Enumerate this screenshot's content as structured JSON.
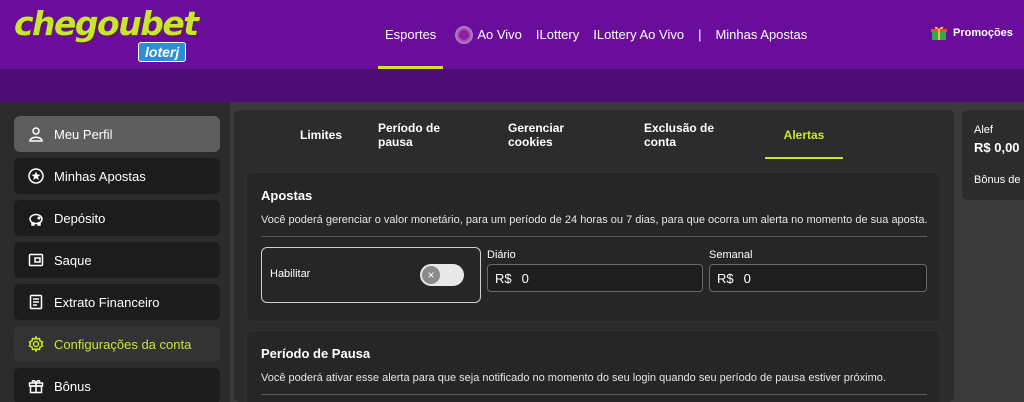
{
  "logo": {
    "main": "chegoubet",
    "sub": "loterj"
  },
  "nav": {
    "items": [
      {
        "label": "Esportes"
      },
      {
        "label": "Ao Vivo"
      },
      {
        "label": "ILottery"
      },
      {
        "label": "ILottery Ao Vivo"
      },
      {
        "label": "Minhas Apostas"
      }
    ],
    "separator": "|",
    "promo_label": "Promoções"
  },
  "sidebar": {
    "items": [
      {
        "label": "Meu Perfil",
        "icon": "user-icon"
      },
      {
        "label": "Minhas Apostas",
        "icon": "star-icon"
      },
      {
        "label": "Depósito",
        "icon": "piggy-bank-icon"
      },
      {
        "label": "Saque",
        "icon": "wallet-icon"
      },
      {
        "label": "Extrato Financeiro",
        "icon": "document-icon"
      },
      {
        "label": "Configurações da conta",
        "icon": "gear-icon"
      },
      {
        "label": "Bônus",
        "icon": "gift-icon"
      }
    ]
  },
  "tabs": [
    {
      "label": "Limites"
    },
    {
      "label": "Período de pausa"
    },
    {
      "label": "Gerenciar cookies"
    },
    {
      "label": "Exclusão de conta"
    },
    {
      "label": "Alertas"
    }
  ],
  "apostas": {
    "title": "Apostas",
    "description": "Você poderá gerenciar o valor monetário, para um período de 24 horas ou 7 dias, para que ocorra um alerta no momento de sua aposta.",
    "habilitar_label": "Habilitar",
    "diario_label": "Diário",
    "semanal_label": "Semanal",
    "currency": "R$",
    "diario_value": "0",
    "semanal_value": "0"
  },
  "pausa": {
    "title": "Período de Pausa",
    "description": "Você poderá ativar esse alerta para que seja notificado no momento do seu login quando seu período de pausa estiver próximo."
  },
  "account": {
    "name": "Alef",
    "balance": "R$ 0,00",
    "bonus_label": "Bônus de c"
  },
  "colors": {
    "accent": "#c8e630",
    "header": "#6a0d9c",
    "subheader": "#4e0d76"
  }
}
